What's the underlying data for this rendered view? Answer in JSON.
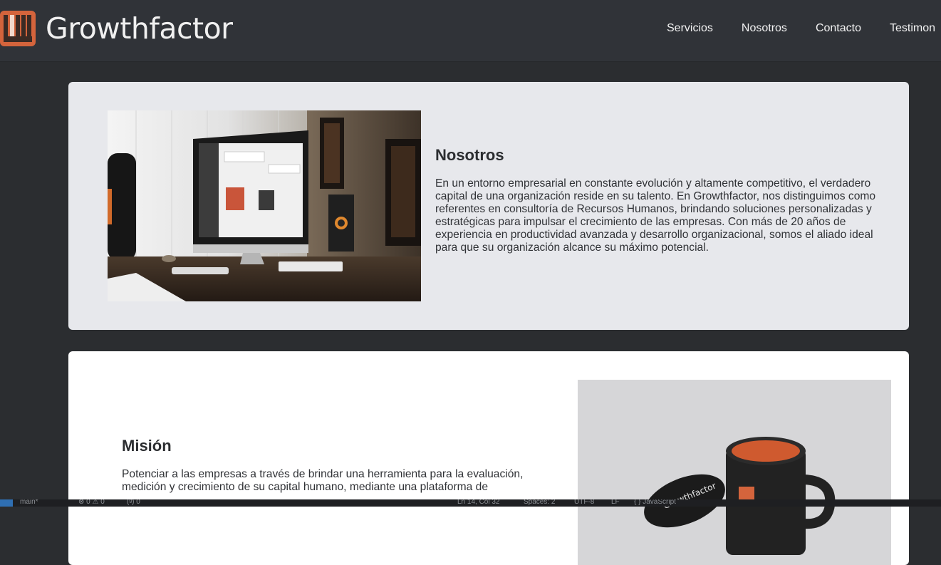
{
  "brand": {
    "name": "Growthfactor",
    "accent": "#d4643c"
  },
  "nav": {
    "items": [
      "Servicios",
      "Nosotros",
      "Contacto",
      "Testimon"
    ]
  },
  "about": {
    "title": "Nosotros",
    "body": "En un entorno empresarial en constante evolución y altamente competitivo, el verdadero capital de una organización reside en su talento. En Growthfactor, nos distinguimos como referentes en consultoría de Recursos Humanos, brindando soluciones personalizadas y estratégicas para impulsar el crecimiento de las empresas. Con más de 20 años de experiencia en productividad avanzada y desarrollo organizacional, somos el aliado ideal para que su organización alcance su máximo potencial.",
    "image_icon": "desk-computer-photo"
  },
  "mision": {
    "title": "Misión",
    "body": "Potenciar a las empresas a través de brindar una herramienta para la evaluación, medición y crecimiento de su capital humano, mediante una plataforma de",
    "image_icon": "branded-mugs-photo",
    "mug_text": "Growthfactor"
  },
  "statusbar": {
    "branch": "main*",
    "problems": "⊗ 0 ⚠ 0",
    "ports": "(ᵍ) 0",
    "cursor": "Ln 14, Col 32",
    "spaces": "Spaces: 2",
    "encoding": "UTF-8",
    "eol": "LF",
    "language": "{ }  JavaScript"
  }
}
